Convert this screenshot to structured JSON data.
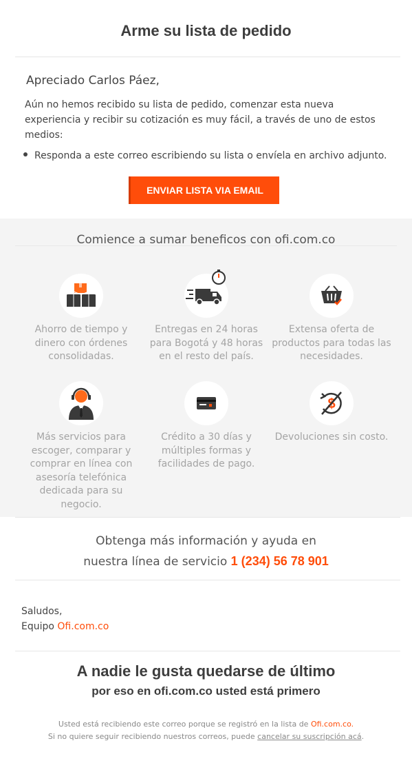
{
  "header": {
    "title": "Arme su lista de pedido"
  },
  "letter": {
    "greeting": "Apreciado Carlos Páez,",
    "intro": "Aún no hemos recibido su lista de pedido, comenzar esta nueva experiencia y recibir su cotización es muy fácil, a través de uno de estos medios:",
    "bullet": "Responda a este correo escribiendo su lista o envíela en archivo adjunto.",
    "cta_label": "ENVIAR LISTA VIA EMAIL"
  },
  "benefits": {
    "title": "Comience a sumar beneficos con ofi.com.co",
    "items": [
      {
        "icon": "boxes-icon",
        "text": "Ahorro de tiempo y dinero con órdenes consolidadas."
      },
      {
        "icon": "delivery-truck-icon",
        "text": "Entregas en 24 horas para Bogotá y 48 horas en el resto del país."
      },
      {
        "icon": "shopping-basket-icon",
        "text": "Extensa oferta de productos para todas las necesidades."
      },
      {
        "icon": "support-agent-icon",
        "text": "Más servicios para escoger, comparar y comprar en línea con asesoría telefónica dedicada para su negocio."
      },
      {
        "icon": "credit-card-icon",
        "text": "Crédito a 30 días y múltiples formas y facilidades de pago."
      },
      {
        "icon": "no-cost-returns-icon",
        "text": "Devoluciones sin costo."
      }
    ]
  },
  "info": {
    "line1": "Obtenga más información y ayuda en",
    "line2": "nuestra línea de servicio",
    "phone": "1 (234) 56 78 901"
  },
  "signature": {
    "line1": "Saludos,",
    "prefix": "Equipo",
    "brand": "Ofi.com.co"
  },
  "tagline": {
    "main": "A nadie le gusta quedarse de último",
    "sub": "por eso en ofi.com.co usted está primero"
  },
  "footer": {
    "line1": "Usted está recibiendo este correo porque se registró en la lista de",
    "brand": "Ofi.com.co.",
    "line2": "Si no quiere seguir recibiendo nuestros correos, puede",
    "unsubscribe": "cancelar su suscripción acá",
    "end": "."
  },
  "colors": {
    "accent": "#ff4d0a",
    "dark": "#333333",
    "muted": "#a4a4a4",
    "band": "#f4f4f4"
  }
}
